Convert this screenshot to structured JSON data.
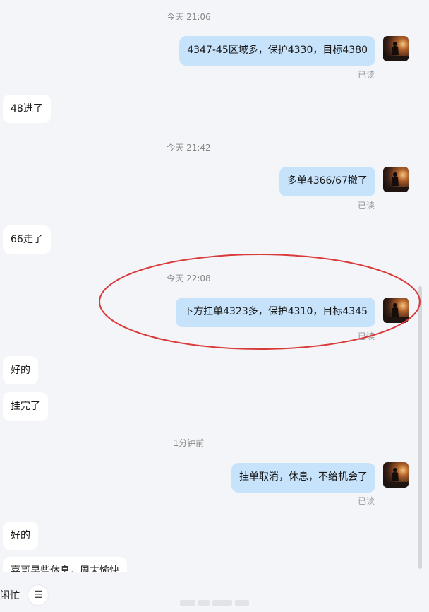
{
  "conversation": {
    "messages": [
      {
        "kind": "time",
        "text": "今天 21:06"
      },
      {
        "kind": "out",
        "text": "4347-45区域多，保护4330，目标4380",
        "status": "已读"
      },
      {
        "kind": "in",
        "text": "48进了"
      },
      {
        "kind": "time",
        "text": "今天 21:42"
      },
      {
        "kind": "out",
        "text": "多单4366/67撤了",
        "status": "已读"
      },
      {
        "kind": "in",
        "text": "66走了"
      },
      {
        "kind": "time",
        "text": "今天 22:08"
      },
      {
        "kind": "out",
        "text": "下方挂单4323多，保护4310，目标4345",
        "status": "已读",
        "highlighted": true
      },
      {
        "kind": "in",
        "text": "好的"
      },
      {
        "kind": "in",
        "text": "挂完了"
      },
      {
        "kind": "time",
        "text": "1分钟前"
      },
      {
        "kind": "out",
        "text": "挂单取消，休息，不给机会了",
        "status": "已读"
      },
      {
        "kind": "in",
        "text": "好的"
      },
      {
        "kind": "in",
        "text": "嘉哥早些休息，周末愉快"
      }
    ]
  },
  "bottom_bar": {
    "status_text": "闲忙",
    "menu_icon": "menu-icon"
  },
  "colors": {
    "outgoing_bubble": "#c7e3fb",
    "incoming_bubble": "#ffffff",
    "background": "#f4f5f9",
    "annotation_circle": "#d93a3a"
  }
}
